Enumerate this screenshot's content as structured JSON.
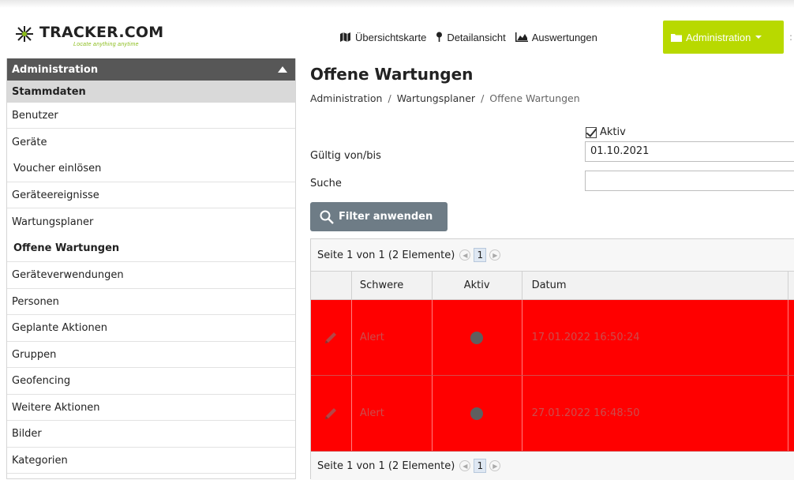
{
  "brand": {
    "name": "TRACKER.COM",
    "tagline": "Locate anything anytime"
  },
  "nav": {
    "items": [
      {
        "label": "Übersichtskarte",
        "icon": "map-icon"
      },
      {
        "label": "Detailansicht",
        "icon": "pin-icon"
      },
      {
        "label": "Auswertungen",
        "icon": "chart-icon"
      }
    ],
    "admin": {
      "label": "Administration",
      "icon": "folder-icon"
    }
  },
  "sidebar": {
    "header": "Administration",
    "section": "Stammdaten",
    "items": [
      "Benutzer",
      "Geräte",
      "Voucher einlösen",
      "Geräteereignisse",
      "Wartungsplaner",
      "Offene Wartungen",
      "Geräteverwendungen",
      "Personen",
      "Geplante Aktionen",
      "Gruppen",
      "Geofencing",
      "Weitere Aktionen",
      "Bilder",
      "Kategorien"
    ]
  },
  "page": {
    "title": "Offene Wartungen",
    "breadcrumb": [
      "Administration",
      "Wartungsplaner",
      "Offene Wartungen"
    ]
  },
  "filter": {
    "active_label": "Aktiv",
    "valid_label": "Gültig von/bis",
    "valid_value": "01.10.2021",
    "search_label": "Suche",
    "search_value": "",
    "apply_label": "Filter anwenden"
  },
  "grid": {
    "pager_text": "Seite 1 von 1 (2 Elemente)",
    "current_page": "1",
    "columns": [
      "",
      "Schwere",
      "Aktiv",
      "Datum",
      ""
    ],
    "rows": [
      {
        "severity": "Alert",
        "date": "17.01.2022 16:50:24"
      },
      {
        "severity": "Alert",
        "date": "27.01.2022 16:48:50"
      }
    ],
    "row_color": "#ff0000"
  },
  "colors": {
    "accent": "#b8d900",
    "sidebar_header": "#575757",
    "button": "#6e7c86"
  }
}
